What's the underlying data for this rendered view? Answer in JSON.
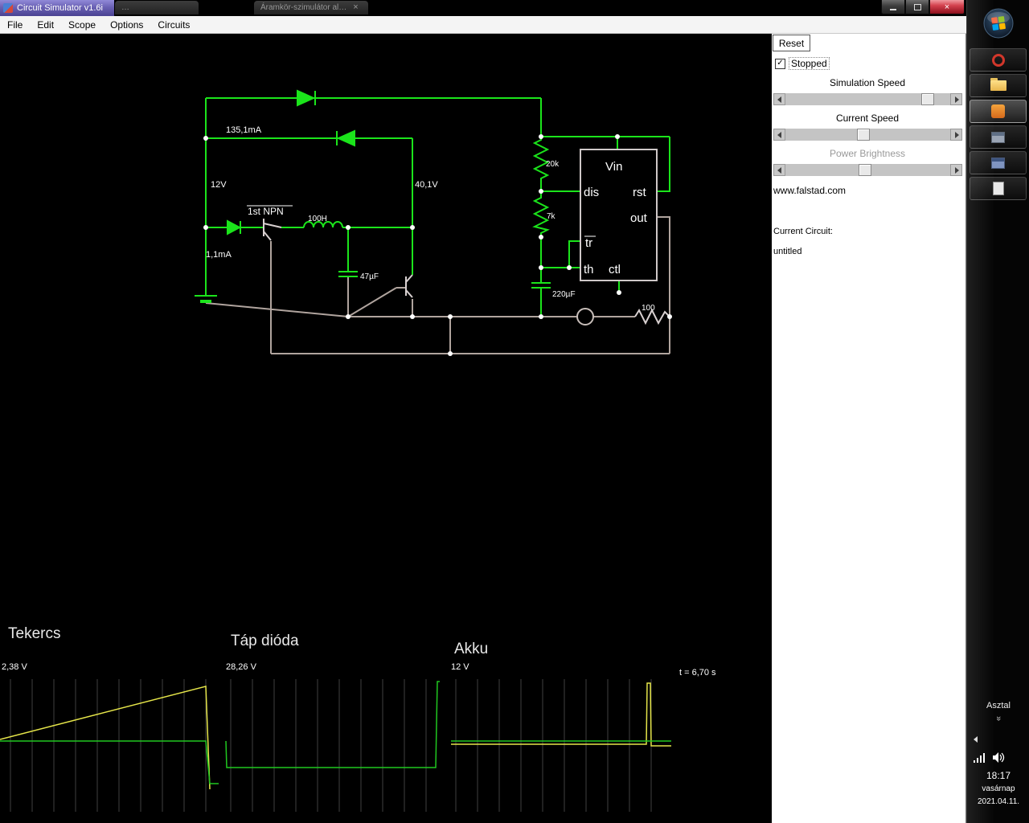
{
  "window": {
    "title": "Circuit Simulator v1.6i",
    "close_glyph": "×",
    "tab_close_glyph": "×"
  },
  "browser_tabs": [
    {
      "label": "…"
    },
    {
      "label": "Áramkör-szimulátor al…"
    }
  ],
  "menu": {
    "items": [
      {
        "label": "File"
      },
      {
        "label": "Edit"
      },
      {
        "label": "Scope"
      },
      {
        "label": "Options"
      },
      {
        "label": "Circuits"
      }
    ]
  },
  "panel": {
    "reset_label": "Reset",
    "stopped_label": "Stopped",
    "stopped_check": "✓",
    "sliders": [
      {
        "label": "Simulation Speed"
      },
      {
        "label": "Current Speed"
      },
      {
        "label": "Power Brightness"
      }
    ],
    "site": "www.falstad.com",
    "current_circuit_label": "Current Circuit:",
    "current_circuit_value": "untitled"
  },
  "circuit": {
    "labels": {
      "current_top": "135,1mA",
      "supply_voltage": "12V",
      "transistor1": "1st NPN",
      "inductor": "100H",
      "node_voltage": "40,1V",
      "base_current": "1,1mA",
      "cap_small": "47µF",
      "resistor_top": "20k",
      "resistor_mid": "7k",
      "cap_big": "220µF",
      "resistor_out": "100"
    },
    "chip_pins": {
      "vin": "Vin",
      "dis": "dis",
      "rst": "rst",
      "out": "out",
      "tr": "tr",
      "th": "th",
      "ctl": "ctl"
    }
  },
  "scopes": [
    {
      "title": "Tekercs",
      "v_label": "2,38 V"
    },
    {
      "title": "Táp dióda",
      "v_label": "28,26 V"
    },
    {
      "title": "Akku",
      "v_label": "12 V",
      "t_label": "t = 6,70 s"
    }
  ],
  "taskbar": {
    "desktop_label": "Asztal",
    "chevron": "»",
    "time": "18:17",
    "day": "vasárnap",
    "date": "2021.04.11."
  },
  "colors": {
    "wire_green": "#1be41b",
    "wire_gray": "#b0a49e",
    "scope_yellow": "#e6e64a",
    "scope_green": "#20c820"
  }
}
